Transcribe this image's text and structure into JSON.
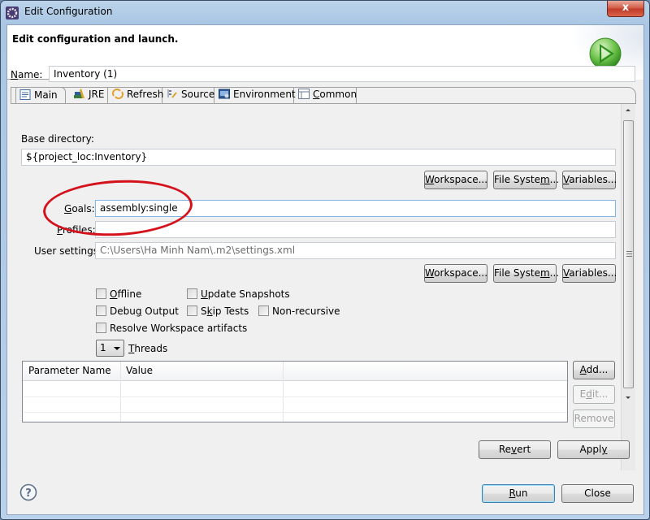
{
  "window": {
    "title": "Edit Configuration",
    "close_label": "x"
  },
  "header": {
    "title": "Edit configuration and launch.",
    "icon": "run-launch-icon"
  },
  "name_field": {
    "label_u": "N",
    "label_rest": "ame:",
    "value": "Inventory (1)"
  },
  "tabs": [
    {
      "label": "Main",
      "icon": "main-tab-icon",
      "active": true
    },
    {
      "label": "JRE",
      "icon": "jre-books-icon",
      "active": false
    },
    {
      "label": "Refresh",
      "icon": "refresh-icon",
      "active": false
    },
    {
      "label": "Source",
      "icon": "source-icon",
      "active": false
    },
    {
      "label": "Environment",
      "icon": "environment-icon",
      "active": false
    },
    {
      "label_u": "C",
      "label_rest": "ommon",
      "icon": "common-icon",
      "active": false
    }
  ],
  "main": {
    "base_directory_label": "Base directory:",
    "base_directory_value": "${project_loc:Inventory}",
    "buttons_row1": {
      "workspace_u": "W",
      "workspace_rest": "orkspace...",
      "filesystem_pre": "File Syste",
      "filesystem_u": "m",
      "filesystem_post": "...",
      "variables_u": "V",
      "variables_rest": "ariables..."
    },
    "goals_label_u": "G",
    "goals_label_rest": "oals:",
    "goals_value": "assembly:single",
    "profiles_label_u": "P",
    "profiles_label_rest": "rofiles:",
    "profiles_value": "",
    "user_settings_label": "User settings:",
    "user_settings_value": "C:\\Users\\Ha Minh Nam\\.m2\\settings.xml",
    "buttons_row2": {
      "workspace_u": "W",
      "workspace_rest": "orkspace...",
      "filesystem_pre": "File Syste",
      "filesystem_u": "m",
      "filesystem_post": "...",
      "variables_u": "V",
      "variables_rest": "ariables..."
    },
    "checkboxes": {
      "offline": {
        "u": "O",
        "rest": "ffline",
        "checked": false
      },
      "update_snapshots": {
        "u": "U",
        "rest": "pdate Snapshots",
        "checked": false
      },
      "debug_output": {
        "pre": "Debu",
        "u": "g",
        "rest": " Output",
        "checked": false
      },
      "skip_tests": {
        "pre": "S",
        "u": "k",
        "rest": "ip Tests",
        "checked": false
      },
      "non_recursive": {
        "label": "Non-recursive",
        "checked": false
      },
      "resolve_workspace": {
        "label": "Resolve Workspace artifacts",
        "checked": false
      }
    },
    "threads_value": "1",
    "threads_label_u": "T",
    "threads_label_rest": "hreads",
    "param_table": {
      "columns": [
        "Parameter Name",
        "Value",
        ""
      ],
      "rows": []
    },
    "table_buttons": {
      "add_u": "A",
      "add_rest": "dd...",
      "edit_pre": "E",
      "edit_u": "d",
      "edit_rest": "it...",
      "remove": "Remove"
    }
  },
  "footer": {
    "revert_pre": "Re",
    "revert_u": "v",
    "revert_rest": "ert",
    "apply_pre": "Appl",
    "apply_u": "y",
    "run_u": "R",
    "run_rest": "un",
    "close": "Close"
  },
  "annotation": {
    "color": "#d4121c",
    "target": "goals"
  }
}
